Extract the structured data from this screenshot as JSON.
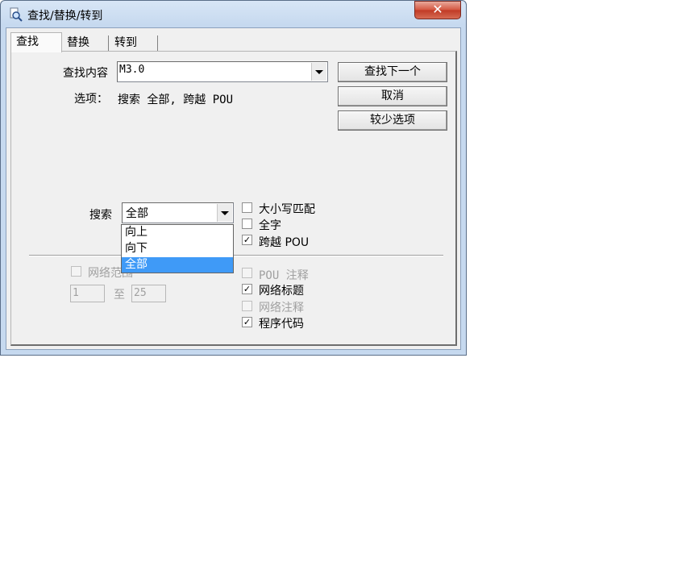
{
  "window": {
    "title": "查找/替换/转到",
    "close_glyph": "✕"
  },
  "tabs": [
    {
      "label": "查找",
      "active": true
    },
    {
      "label": "替换",
      "active": false
    },
    {
      "label": "转到",
      "active": false
    }
  ],
  "find": {
    "label": "查找内容",
    "value": "M3.0"
  },
  "options_summary": {
    "label": "选项：",
    "text": "搜索 全部, 跨越 POU"
  },
  "buttons": {
    "find_next": "查找下一个",
    "cancel": "取消",
    "fewer_options": "较少选项"
  },
  "search": {
    "label": "搜索",
    "selected": "全部",
    "options": [
      "向上",
      "向下",
      "全部"
    ],
    "highlighted_index": 2
  },
  "checkboxes_top": [
    {
      "label": "大小写匹配",
      "checked": false,
      "enabled": true
    },
    {
      "label": "全字",
      "checked": false,
      "enabled": true
    },
    {
      "label": "跨越 POU",
      "checked": true,
      "enabled": true
    }
  ],
  "network_range": {
    "label": "网络范围",
    "checked": false,
    "enabled": false,
    "from": "1",
    "to_label": "至",
    "to": "25"
  },
  "checkboxes_bottom": [
    {
      "label": "POU 注释",
      "checked": false,
      "enabled": false
    },
    {
      "label": "网络标题",
      "checked": true,
      "enabled": true
    },
    {
      "label": "网络注释",
      "checked": false,
      "enabled": false
    },
    {
      "label": "程序代码",
      "checked": true,
      "enabled": true
    }
  ],
  "check_glyph": "✓",
  "colors": {
    "selection": "#3f9af7",
    "close_button": "#c03a25"
  }
}
